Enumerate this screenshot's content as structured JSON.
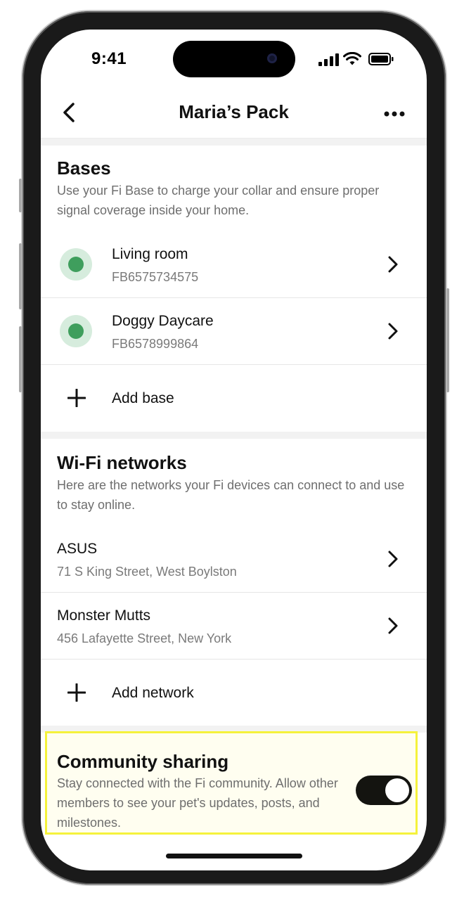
{
  "status_bar": {
    "time": "9:41"
  },
  "nav": {
    "title": "Maria’s Pack"
  },
  "bases": {
    "title": "Bases",
    "description": "Use your Fi Base to charge your collar and ensure proper signal coverage inside your home.",
    "items": [
      {
        "name": "Living room",
        "serial": "FB6575734575",
        "status_color": "#3f9e5d"
      },
      {
        "name": "Doggy Daycare",
        "serial": "FB6578999864",
        "status_color": "#3f9e5d"
      }
    ],
    "add_label": "Add base"
  },
  "wifi": {
    "title": "Wi-Fi networks",
    "description": "Here are the networks your Fi devices can connect to and use to stay online.",
    "items": [
      {
        "name": "ASUS",
        "address": "71 S King Street, West Boylston"
      },
      {
        "name": "Monster Mutts",
        "address": "456 Lafayette Street, New York"
      }
    ],
    "add_label": "Add network"
  },
  "community": {
    "title": "Community sharing",
    "description": "Stay connected with the Fi community. Allow other members to see your pet's updates, posts, and milestones.",
    "toggle_on": true,
    "highlight_color": "#f5f23c"
  }
}
